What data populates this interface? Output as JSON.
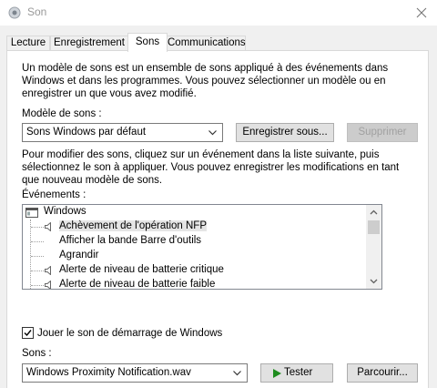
{
  "window": {
    "title": "Son",
    "app_icon": "speaker-app-icon",
    "close_icon": "close-icon"
  },
  "tabs": [
    {
      "label": "Lecture",
      "active": false
    },
    {
      "label": "Enregistrement",
      "active": false
    },
    {
      "label": "Sons",
      "active": true
    },
    {
      "label": "Communications",
      "active": false
    }
  ],
  "intro_text": [
    "Un modèle de sons est un ensemble de sons appliqué à des événements dans",
    "Windows et dans les programmes. Vous pouvez sélectionner un modèle ou en",
    "enregistrer un que vous avez modifié."
  ],
  "scheme": {
    "label": "Modèle de sons :",
    "value": "Sons Windows par défaut",
    "save_button": "Enregistrer sous...",
    "delete_button": "Supprimer"
  },
  "instructions_text": [
    "Pour modifier des sons, cliquez sur un événement dans la liste suivante, puis",
    "sélectionnez le son à appliquer. Vous pouvez enregistrer les modifications en tant",
    "que nouveau modèle de sons."
  ],
  "events": {
    "label": "Événements :",
    "group": "Windows",
    "items": [
      {
        "label": "Achèvement de l'opération NFP",
        "has_sound": true,
        "selected": true
      },
      {
        "label": "Afficher la bande Barre d'outils",
        "has_sound": false,
        "selected": false
      },
      {
        "label": "Agrandir",
        "has_sound": false,
        "selected": false
      },
      {
        "label": "Alerte de niveau de batterie critique",
        "has_sound": true,
        "selected": false
      },
      {
        "label": "Alerte de niveau de batterie faible",
        "has_sound": true,
        "selected": false
      }
    ]
  },
  "startup_sound": {
    "label": "Jouer le son de démarrage de Windows",
    "checked": true
  },
  "sounds": {
    "label": "Sons :",
    "value": "Windows Proximity Notification.wav",
    "test_button": "Tester",
    "browse_button": "Parcourir..."
  },
  "colors": {
    "play_icon": "#1e8c1e",
    "disabled_text": "#a0a0a0",
    "selection": "#e5e5e5"
  }
}
